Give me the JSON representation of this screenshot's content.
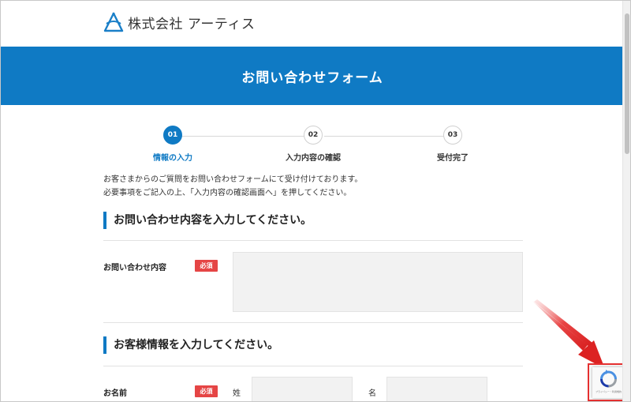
{
  "header": {
    "company_name": "株式会社 アーティス"
  },
  "hero": {
    "title": "お問い合わせフォーム"
  },
  "steps": [
    {
      "number": "01",
      "label": "情報の入力",
      "active": true
    },
    {
      "number": "02",
      "label": "入力内容の確認",
      "active": false
    },
    {
      "number": "03",
      "label": "受付完了",
      "active": false
    }
  ],
  "intro": {
    "line1": "お客さまからのご質問をお問い合わせフォームにて受け付けております。",
    "line2": "必要事項をご記入の上、「入力内容の確認画面へ」を押してください。"
  },
  "section_inquiry": {
    "heading": "お問い合わせ内容を入力してください。",
    "field_label": "お問い合わせ内容",
    "required_badge": "必須"
  },
  "section_customer": {
    "heading": "お客様情報を入力してください。",
    "name_label": "お名前",
    "required_badge": "必須",
    "last_name_label": "姓",
    "first_name_label": "名"
  },
  "recaptcha": {
    "privacy_text": "プライバシー・利用規約"
  },
  "colors": {
    "brand": "#0f7ac4",
    "required": "#e54545",
    "highlight": "#e53030"
  },
  "icons": {
    "logo": "artis-logo-icon",
    "arrow": "red-arrow-icon",
    "recaptcha": "recaptcha-icon"
  }
}
